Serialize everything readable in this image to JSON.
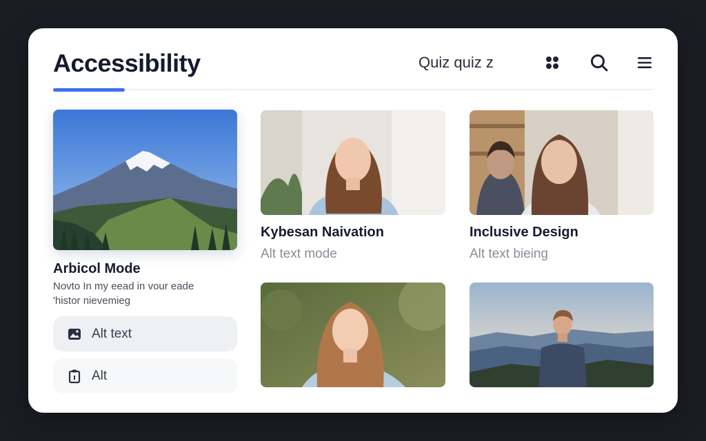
{
  "header": {
    "title": "Accessibility",
    "quiz_label": "Quiz quiz z",
    "icons": [
      "grid-flower-icon",
      "search-icon",
      "menu-icon"
    ]
  },
  "featured": {
    "image": "mountain-landscape",
    "title": "Arbicol Mode",
    "subtitle_line1": "Novto In my eead in vour eade",
    "subtitle_line2": "'histor nievemieg"
  },
  "options": [
    {
      "label": "Alt text",
      "icon": "image-icon"
    },
    {
      "label": "Alt",
      "icon": "clipboard-icon"
    }
  ],
  "cards": [
    {
      "image": "portrait-woman-indoor",
      "title": "Kybesan Naivation",
      "subtitle": "Alt text mode"
    },
    {
      "image": "portrait-woman-office",
      "title": "Inclusive Design",
      "subtitle": "Alt text bieing"
    },
    {
      "image": "portrait-woman-outdoor",
      "title": "",
      "subtitle": ""
    },
    {
      "image": "portrait-man-mountain",
      "title": "",
      "subtitle": ""
    }
  ],
  "colors": {
    "accent": "#3b6ff0",
    "background": "#1b1d24",
    "panel": "#ffffff"
  }
}
